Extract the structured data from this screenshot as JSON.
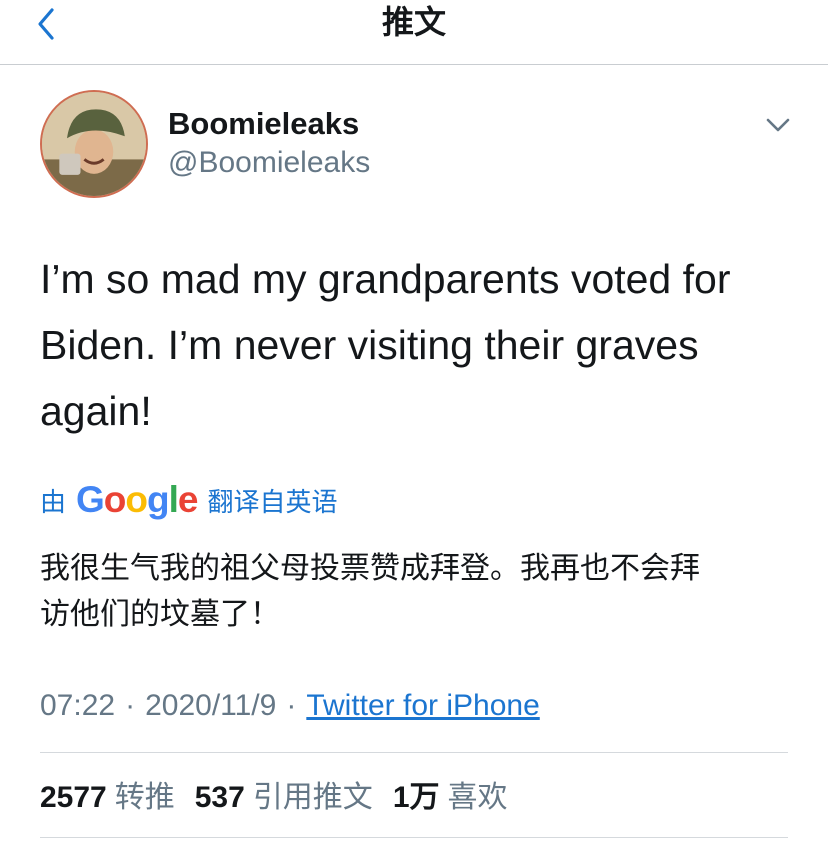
{
  "nav": {
    "title": "推文",
    "back_icon": "chevron-left-icon"
  },
  "colors": {
    "accent": "#1b75d0",
    "text": "#14171a",
    "secondary": "#657786",
    "divider": "#d5d9dd",
    "avatar_ring": "#cf6d52"
  },
  "user": {
    "display_name": "Boomieleaks",
    "handle": "@Boomieleaks",
    "menu_icon": "chevron-down-icon"
  },
  "tweet": {
    "lines": [
      "I’m so mad my grandparents voted for",
      "Biden. I’m never visiting their graves",
      "again!"
    ]
  },
  "translation": {
    "by": "由",
    "provider": [
      "G",
      "o",
      "o",
      "g",
      "l",
      "e"
    ],
    "provider_colors": [
      "#4285f4",
      "#ea4335",
      "#fbbc05",
      "#4285f4",
      "#34a853",
      "#ea4335"
    ],
    "suffix": "翻译自英语",
    "lines": [
      "我很生气我的祖父母投票赞成拜登。我再也不会拜",
      "访他们的坟墓了！"
    ]
  },
  "meta": {
    "time": "07:22",
    "separator": "·",
    "date": "2020/11/9",
    "source": "Twitter for iPhone"
  },
  "stats": [
    {
      "count": "2577",
      "label": "转推"
    },
    {
      "count": "537",
      "label": "引用推文"
    },
    {
      "count": "1万",
      "label": "喜欢"
    }
  ]
}
